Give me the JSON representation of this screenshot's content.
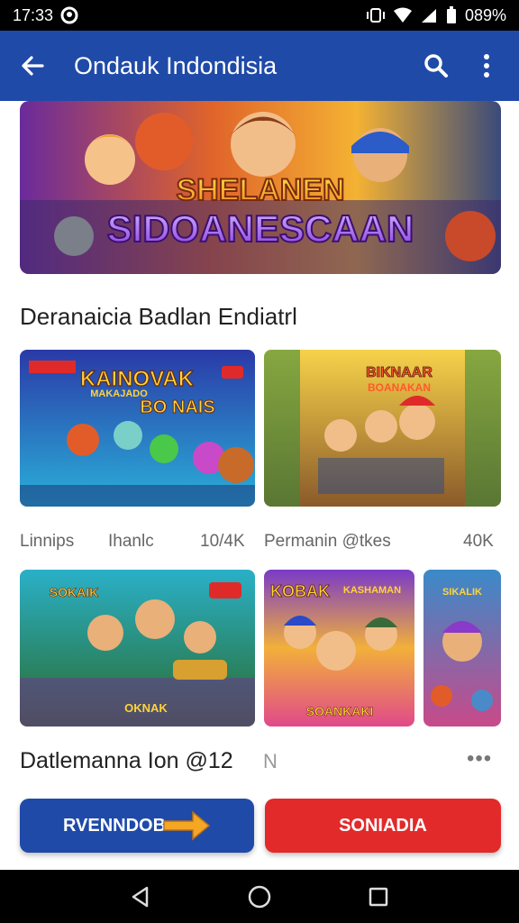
{
  "status_bar": {
    "time": "17:33",
    "battery": "089%"
  },
  "app_bar": {
    "title": "Ondauk Indondisia",
    "back_icon": "arrow-left-icon",
    "search_icon": "search-icon",
    "menu_icon": "more-vert-icon"
  },
  "banner": {
    "line1": "SHELANEN",
    "line2": "SIDOANESCAAN"
  },
  "section": {
    "title": "Deranaicia Badlan Endiatrl"
  },
  "cards_row1": [
    {
      "title_line1": "KAINOVAK",
      "title_line2": "BO NAIS",
      "subtitle": "MAKAJADO",
      "tag": "",
      "meta_left": "Linnips",
      "meta_mid": "Ihanlc",
      "meta_right": "10/4K"
    },
    {
      "title_line1": "BIKNAAR",
      "title_line2": "BOANAKAN",
      "subtitle": "",
      "meta_left": "Permanin @tkes",
      "meta_right": "40K"
    }
  ],
  "cards_row2": [
    {
      "title": "SOKAIK",
      "tag": "",
      "caption": "OKNAK"
    },
    {
      "title": "KOBAK",
      "tag": "KASHAMAN",
      "caption": "SOANKAKI"
    },
    {
      "title": "SIKALIK",
      "caption": ""
    }
  ],
  "row2_meta": {
    "title": "Datlemanna Ion @12",
    "extra": "N",
    "more": "•••"
  },
  "buttons": {
    "primary": "RVENNDOB",
    "secondary": "SONIADIA"
  },
  "colors": {
    "app_bar": "#1f4aa8",
    "primary_button": "#1f4aa8",
    "secondary_button": "#e22a2a",
    "arrow": "#f5a623"
  }
}
